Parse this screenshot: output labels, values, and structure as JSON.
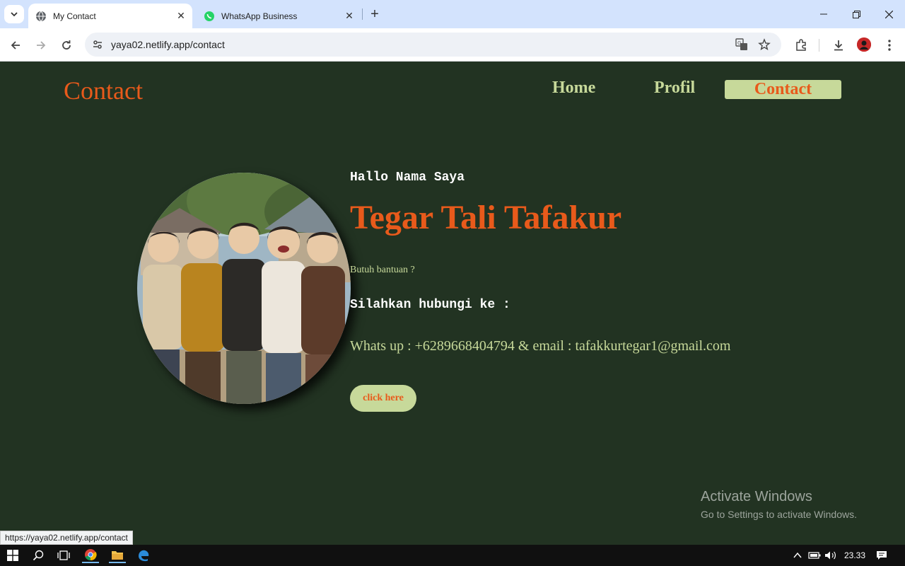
{
  "browser": {
    "tabs": [
      {
        "title": "My Contact",
        "icon": "globe-icon",
        "active": true
      },
      {
        "title": "WhatsApp Business",
        "icon": "whatsapp-icon",
        "active": false
      }
    ],
    "url": "yaya02.netlify.app/contact",
    "status_url": "https://yaya02.netlify.app/contact"
  },
  "site": {
    "brand": "Contact",
    "nav": [
      {
        "label": "Home"
      },
      {
        "label": "Profil"
      },
      {
        "label": "Contact",
        "active": true
      }
    ]
  },
  "hero": {
    "greeting": "Hallo Nama Saya",
    "name": "Tegar Tali Tafakur",
    "help_text": "Butuh bantuan ?",
    "contact_heading": "Silahkan hubungi ke :",
    "contact_line": "Whats up : +6289668404794 & email : tafakkurtegar1@gmail.com",
    "button_label": "click here"
  },
  "watermark": {
    "line1": "Activate Windows",
    "line2": "Go to Settings to activate Windows."
  },
  "taskbar": {
    "time": "23.33"
  },
  "colors": {
    "background": "#223322",
    "accent": "#e85a1b",
    "nav_text": "#c7d99a"
  }
}
